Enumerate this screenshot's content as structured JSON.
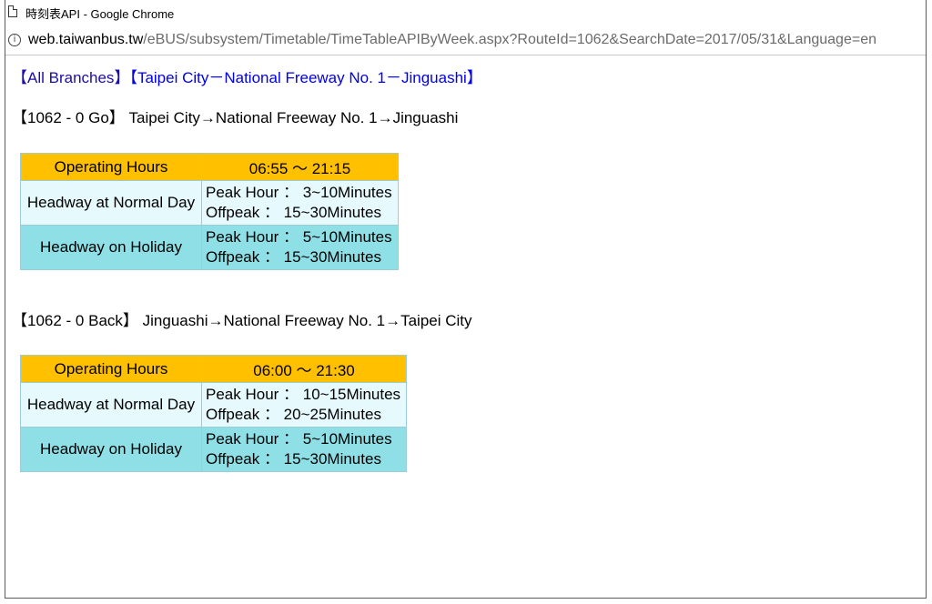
{
  "window": {
    "title": "時刻表API - Google Chrome",
    "url_host": "web.taiwanbus.tw",
    "url_path": "/eBUS/subsystem/Timetable/TimeTableAPIByWeek.aspx?RouteId=1062&SearchDate=2017/05/31&Language=en"
  },
  "branches": {
    "all_label": "All Branches",
    "current_label": "Taipei City－National Freeway No. 1－Jinguashi"
  },
  "routes": [
    {
      "code": "1062 - 0 Go",
      "description": "Taipei City→National Freeway No. 1→Jinguashi",
      "operating_hours_label": "Operating Hours",
      "operating_hours": "06:55 ～ 21:15",
      "normal_label": "Headway at Normal Day",
      "normal_peak": "Peak Hour ： 3~10Minutes",
      "normal_offpeak": "Offpeak ： 15~30Minutes",
      "holiday_label": "Headway on Holiday",
      "holiday_peak": "Peak Hour ： 5~10Minutes",
      "holiday_offpeak": "Offpeak ： 15~30Minutes"
    },
    {
      "code": "1062 - 0 Back",
      "description": "Jinguashi→National Freeway No. 1→Taipei City",
      "operating_hours_label": "Operating Hours",
      "operating_hours": "06:00 ～ 21:30",
      "normal_label": "Headway at Normal Day",
      "normal_peak": "Peak Hour ： 10~15Minutes",
      "normal_offpeak": "Offpeak ： 20~25Minutes",
      "holiday_label": "Headway on Holiday",
      "holiday_peak": "Peak Hour ： 5~10Minutes",
      "holiday_offpeak": "Offpeak ： 15~30Minutes"
    }
  ],
  "colors": {
    "header_bg": "#ffc000",
    "normal_bg": "#e6f9fd",
    "holiday_bg": "#8fe0e6",
    "link": "#1a0dab"
  },
  "icons": [
    "page-icon",
    "info-icon"
  ]
}
